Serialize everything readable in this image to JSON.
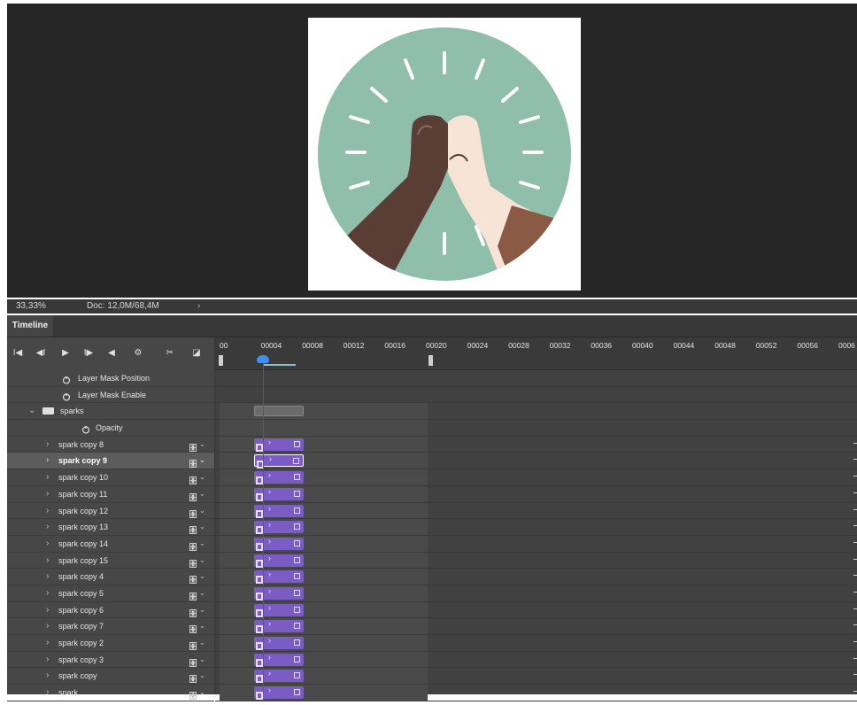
{
  "status": {
    "zoom": "33,33%",
    "doc": "Doc: 12,0M/68,4M",
    "arrow": "›"
  },
  "panel": {
    "tab": "Timeline"
  },
  "controls": [
    {
      "name": "go-to-first-frame-button",
      "glyph": "I◀"
    },
    {
      "name": "previous-frame-button",
      "glyph": "◀I"
    },
    {
      "name": "play-button",
      "glyph": "▶"
    },
    {
      "name": "next-frame-button",
      "glyph": "I▶"
    },
    {
      "name": "audio-button",
      "glyph": "◀"
    },
    {
      "name": "settings-gear-button",
      "glyph": "⚙"
    },
    {
      "name": "split-scissors-button",
      "glyph": "✂"
    },
    {
      "name": "transition-button",
      "glyph": "◪"
    }
  ],
  "ruler": {
    "ticks": [
      "00",
      "00004",
      "00008",
      "00012",
      "00016",
      "00020",
      "00024",
      "00028",
      "00032",
      "00036",
      "00040",
      "00044",
      "00048",
      "00052",
      "00056",
      "0006"
    ]
  },
  "layers": [
    {
      "type": "prop",
      "label": "Layer Mask Position"
    },
    {
      "type": "prop",
      "label": "Layer Mask Enable"
    },
    {
      "type": "group",
      "label": "sparks"
    },
    {
      "type": "prop2",
      "label": "Opacity"
    },
    {
      "type": "layer",
      "label": "spark copy 8"
    },
    {
      "type": "layer",
      "label": "spark copy 9",
      "selected": true
    },
    {
      "type": "layer",
      "label": "spark copy 10"
    },
    {
      "type": "layer",
      "label": "spark copy 11"
    },
    {
      "type": "layer",
      "label": "spark copy 12"
    },
    {
      "type": "layer",
      "label": "spark copy 13"
    },
    {
      "type": "layer",
      "label": "spark copy 14"
    },
    {
      "type": "layer",
      "label": "spark copy 15"
    },
    {
      "type": "layer",
      "label": "spark copy 4"
    },
    {
      "type": "layer",
      "label": "spark copy 5"
    },
    {
      "type": "layer",
      "label": "spark copy 6"
    },
    {
      "type": "layer",
      "label": "spark copy 7"
    },
    {
      "type": "layer",
      "label": "spark copy 2"
    },
    {
      "type": "layer",
      "label": "spark copy 3"
    },
    {
      "type": "layer",
      "label": "spark copy"
    },
    {
      "type": "layer",
      "label": "spark"
    }
  ],
  "colors": {
    "canvas_bg": "#262626",
    "illustration_bg": "#8fbeaa",
    "clip": "#7a5cc4",
    "playhead": "#d9262a",
    "playhead_head": "#3d8ef0"
  }
}
